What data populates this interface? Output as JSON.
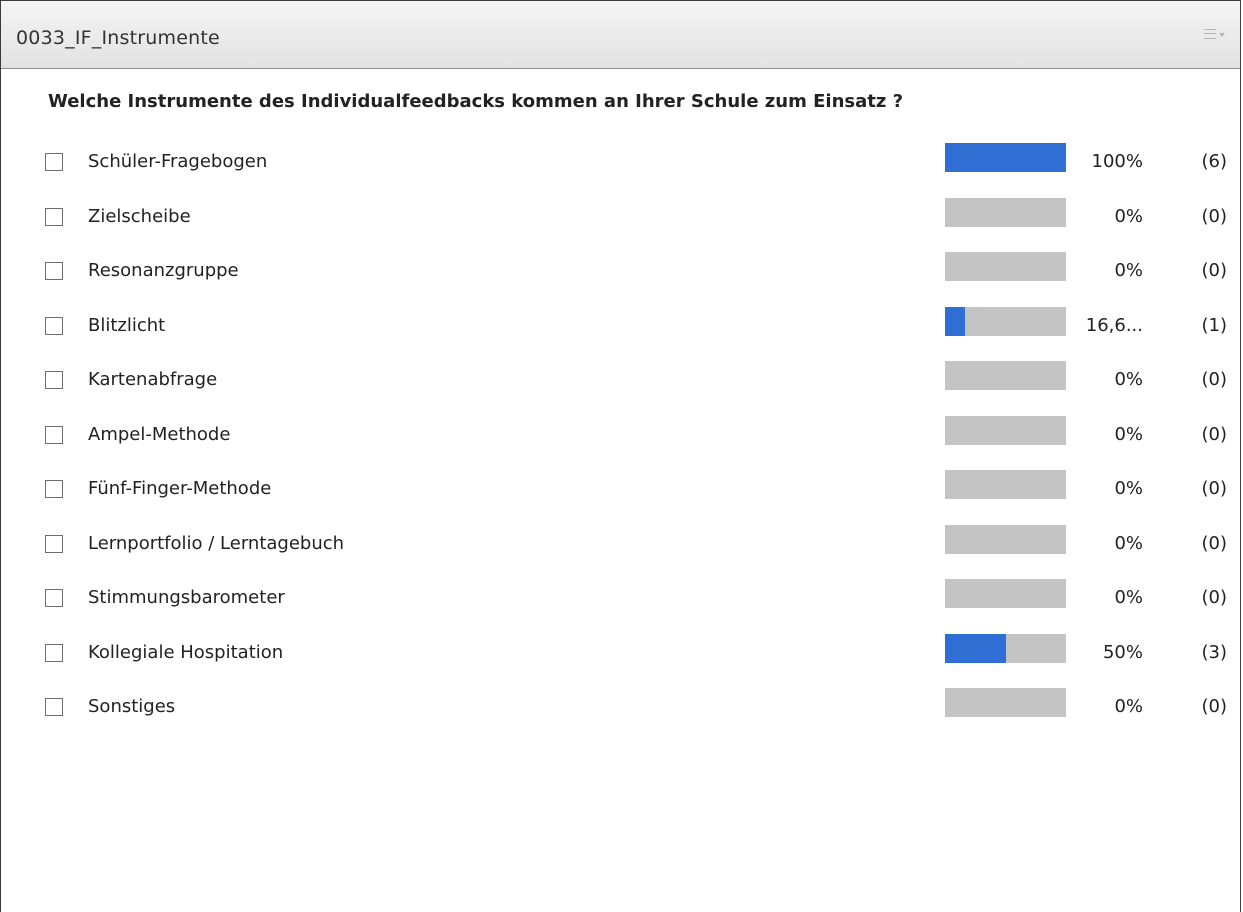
{
  "pod": {
    "title": "0033_IF_Instrumente",
    "menu_icon": "pod-menu-icon"
  },
  "question": "Welche Instrumente des Individualfeedbacks kommen an Ihrer Schule zum Einsatz ?",
  "colors": {
    "bar_fill": "#2f6ed3",
    "bar_track": "#c4c4c4"
  },
  "options": [
    {
      "label": "Schüler-Fragebogen",
      "percent_text": "100%",
      "count_text": "(6)",
      "fraction": 1.0
    },
    {
      "label": "Zielscheibe",
      "percent_text": "0%",
      "count_text": "(0)",
      "fraction": 0
    },
    {
      "label": "Resonanzgruppe",
      "percent_text": "0%",
      "count_text": "(0)",
      "fraction": 0
    },
    {
      "label": "Blitzlicht",
      "percent_text": "16,6...",
      "count_text": "(1)",
      "fraction": 0.1667
    },
    {
      "label": "Kartenabfrage",
      "percent_text": "0%",
      "count_text": "(0)",
      "fraction": 0
    },
    {
      "label": "Ampel-Methode",
      "percent_text": "0%",
      "count_text": "(0)",
      "fraction": 0
    },
    {
      "label": "Fünf-Finger-Methode",
      "percent_text": "0%",
      "count_text": "(0)",
      "fraction": 0
    },
    {
      "label": "Lernportfolio / Lerntagebuch",
      "percent_text": "0%",
      "count_text": "(0)",
      "fraction": 0
    },
    {
      "label": "Stimmungsbarometer",
      "percent_text": "0%",
      "count_text": "(0)",
      "fraction": 0
    },
    {
      "label": "Kollegiale Hospitation",
      "percent_text": "50%",
      "count_text": "(3)",
      "fraction": 0.5
    },
    {
      "label": "Sonstiges",
      "percent_text": "0%",
      "count_text": "(0)",
      "fraction": 0
    }
  ]
}
